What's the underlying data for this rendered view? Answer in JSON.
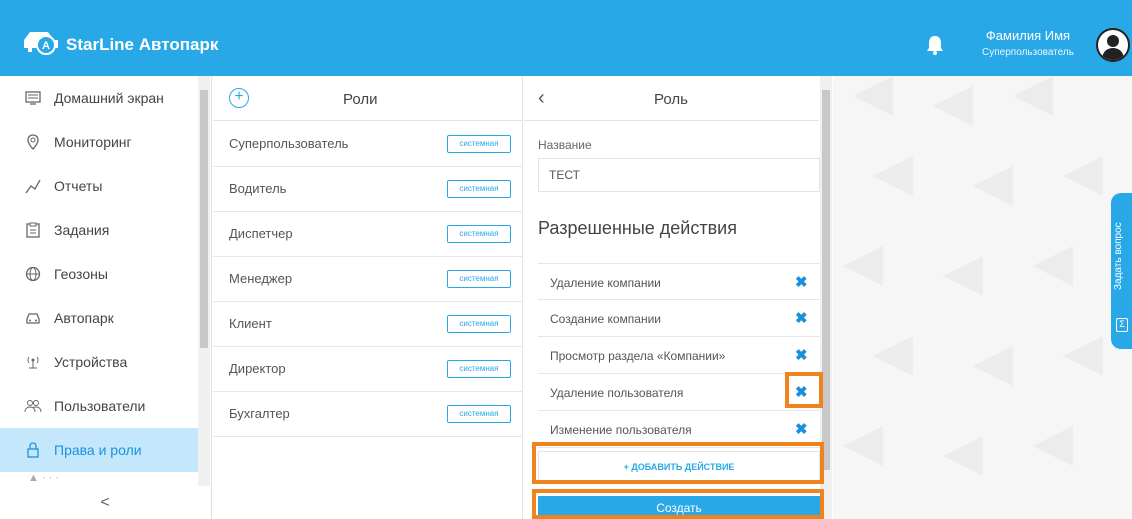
{
  "app": {
    "title": "StarLine Автопарк"
  },
  "user": {
    "name": "Фамилия Имя",
    "role": "Суперпользователь"
  },
  "sidebar": {
    "items": [
      {
        "label": "Домашний экран",
        "icon": "home-screen-icon"
      },
      {
        "label": "Мониторинг",
        "icon": "location-pin-icon"
      },
      {
        "label": "Отчеты",
        "icon": "chart-line-icon"
      },
      {
        "label": "Задания",
        "icon": "clipboard-icon"
      },
      {
        "label": "Геозоны",
        "icon": "globe-icon"
      },
      {
        "label": "Автопарк",
        "icon": "car-icon"
      },
      {
        "label": "Устройства",
        "icon": "antenna-icon"
      },
      {
        "label": "Пользователи",
        "icon": "users-icon"
      },
      {
        "label": "Права и роли",
        "icon": "lock-icon",
        "active": true
      }
    ],
    "collapse": "<"
  },
  "roles": {
    "title": "Роли",
    "badge": "системная",
    "items": [
      "Суперпользователь",
      "Водитель",
      "Диспетчер",
      "Менеджер",
      "Клиент",
      "Директор",
      "Бухгалтер"
    ]
  },
  "role_detail": {
    "title": "Роль",
    "name_label": "Название",
    "name_value": "ТЕСТ",
    "permissions_heading": "Разрешенные действия",
    "permissions": [
      "Удаление компании",
      "Создание компании",
      "Просмотр раздела «Компании»",
      "Удаление пользователя",
      "Изменение пользователя"
    ],
    "add_action": "+ ДОБАВИТЬ ДЕЙСТВИЕ",
    "create": "Создать"
  },
  "side_tab": {
    "label": "Задать вопрос"
  },
  "colors": {
    "brand": "#29a8e8",
    "highlight": "#f0831e",
    "active_bg": "#c4e7fb"
  }
}
